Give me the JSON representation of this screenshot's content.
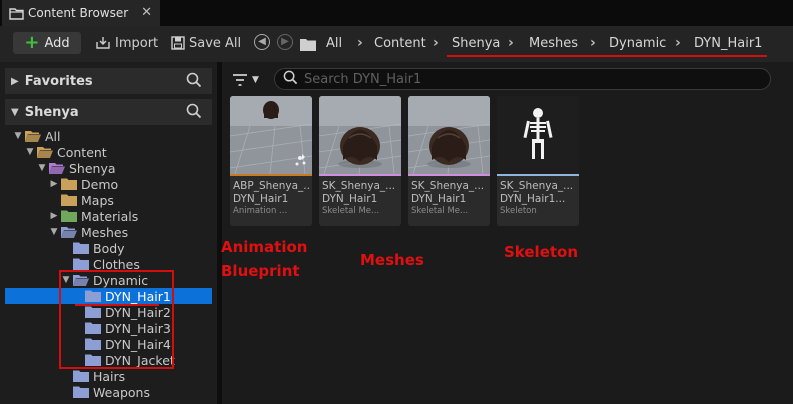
{
  "window": {
    "tab_title": "Content Browser",
    "tab_close": "✕"
  },
  "toolbar": {
    "add_label": "Add",
    "import_label": "Import",
    "save_all_label": "Save All",
    "breadcrumb": [
      "All",
      "Content",
      "Shenya",
      "Meshes",
      "Dynamic",
      "DYN_Hair1"
    ],
    "separator": "›"
  },
  "sidebar": {
    "favorites_label": "Favorites",
    "project_label": "Shenya",
    "tree": [
      {
        "label": "All",
        "expanded": true,
        "folder_color": "#c9a15a"
      },
      {
        "label": "Content",
        "expanded": true,
        "folder_color": "#c9a15a"
      },
      {
        "label": "Shenya",
        "expanded": true,
        "folder_color": "#b07bd6"
      },
      {
        "label": "Demo",
        "expanded": false,
        "folder_color": "#c9a15a"
      },
      {
        "label": "Maps",
        "expanded": null,
        "folder_color": "#c9a15a"
      },
      {
        "label": "Materials",
        "expanded": false,
        "folder_color": "#6fa85c"
      },
      {
        "label": "Meshes",
        "expanded": true,
        "folder_color": "#8c9ed3"
      },
      {
        "label": "Body",
        "expanded": null,
        "folder_color": "#8c9ed3"
      },
      {
        "label": "Clothes",
        "expanded": null,
        "folder_color": "#8c9ed3"
      },
      {
        "label": "Dynamic",
        "expanded": true,
        "folder_color": "#8c9ed3"
      },
      {
        "label": "DYN_Hair1",
        "expanded": null,
        "folder_color": "#8c9ed3",
        "selected": true
      },
      {
        "label": "DYN_Hair2",
        "expanded": null,
        "folder_color": "#8c9ed3"
      },
      {
        "label": "DYN_Hair3",
        "expanded": null,
        "folder_color": "#8c9ed3"
      },
      {
        "label": "DYN_Hair4",
        "expanded": null,
        "folder_color": "#8c9ed3"
      },
      {
        "label": "DYN_Jacket",
        "expanded": null,
        "folder_color": "#8c9ed3"
      },
      {
        "label": "Hairs",
        "expanded": null,
        "folder_color": "#8c9ed3"
      },
      {
        "label": "Weapons",
        "expanded": null,
        "folder_color": "#8c9ed3"
      }
    ]
  },
  "content": {
    "search_placeholder": "Search DYN_Hair1",
    "assets": [
      {
        "name": "ABP_Shenya_...",
        "subname": "DYN_Hair1",
        "type": "Animation ...",
        "band_color": "#c87a1e",
        "thumb": "anim"
      },
      {
        "name": "SK_Shenya_...",
        "subname": "DYN_Hair1",
        "type": "Skeletal Me...",
        "band_color": "#d08ee0",
        "thumb": "mesh"
      },
      {
        "name": "SK_Shenya_...",
        "subname": "DYN_Hair1",
        "type": "Skeletal Me...",
        "band_color": "#d08ee0",
        "thumb": "mesh"
      },
      {
        "name": "SK_Shenya_...",
        "subname": "DYN_Hair1...",
        "type": "Skeleton",
        "band_color": "#8fb6de",
        "thumb": "skeleton"
      }
    ]
  },
  "annotations": {
    "anim_line1": "Animation",
    "anim_line2": "Blueprint",
    "meshes": "Meshes",
    "skeleton": "Skeleton",
    "color": "#e01010"
  }
}
